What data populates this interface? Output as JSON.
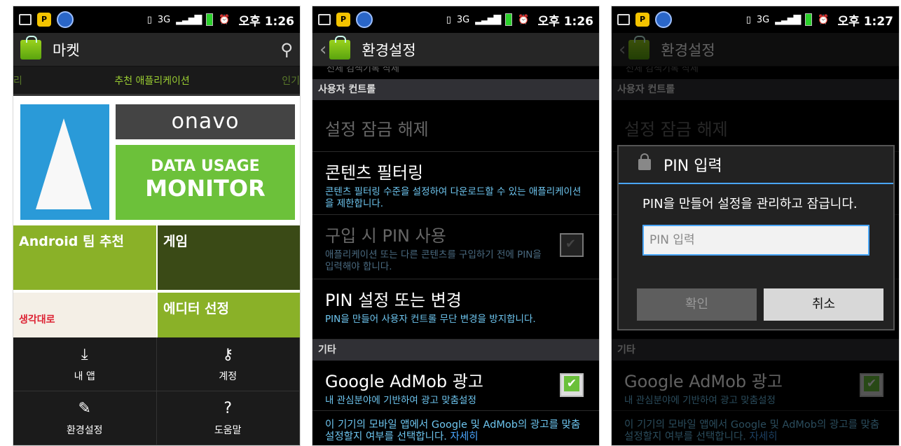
{
  "status": {
    "time1": "오후 1:26",
    "time2": "오후 1:26",
    "time3": "오후 1:27",
    "net": "3G"
  },
  "market": {
    "title": "마켓",
    "tabs": {
      "left": "리",
      "center": "추천 애플리케이션",
      "right": "인기"
    },
    "banner": {
      "logo": "onavo",
      "line1": "DATA USAGE",
      "line2": "MONITOR"
    },
    "tiles": {
      "android": "Android 팀 추천",
      "game": "게임",
      "lg": "생각대로",
      "editor": "에디터 선정"
    },
    "menu": [
      {
        "label": "내 앱",
        "icon": "download-icon"
      },
      {
        "label": "계정",
        "icon": "key-icon"
      },
      {
        "label": "환경설정",
        "icon": "wrench-icon"
      },
      {
        "label": "도움말",
        "icon": "help-icon"
      }
    ]
  },
  "settings": {
    "title": "환경설정",
    "cut": "전체 검색기록 삭제",
    "sec_user": "사용자 컨트롤",
    "unlock": "설정 잠금 해제",
    "filter_t": "콘텐츠 필터링",
    "filter_s": "콘텐츠 필터링 수준을 설정하여 다운로드할 수 있는 애플리케이션을 제한합니다.",
    "pin_use_t": "구입 시 PIN 사용",
    "pin_use_s": "애플리케이션 또는 다른 콘텐츠를 구입하기 전에 PIN을 입력해야 합니다.",
    "pin_set_t": "PIN 설정 또는 변경",
    "pin_set_s": "PIN을 만들어 사용자 컨트롤 무단 변경을 방지합니다.",
    "sec_etc": "기타",
    "admob_t": "Google AdMob 광고",
    "admob_s": "내 관심분야에 기반하여 광고 맞춤설정",
    "device_s": "이 기기의 모바일 앱에서 Google 및 AdMob의 광고를 맞춤설정할지 여부를 선택합니다.",
    "more": "자세히"
  },
  "dialog": {
    "title": "PIN 입력",
    "message": "PIN을 만들어 설정을 관리하고 잠급니다.",
    "placeholder": "PIN 입력",
    "ok": "확인",
    "cancel": "취소"
  },
  "colors": {
    "accent": "#4aa6ff",
    "green": "#8ab128",
    "summary": "#6ec6f0"
  }
}
